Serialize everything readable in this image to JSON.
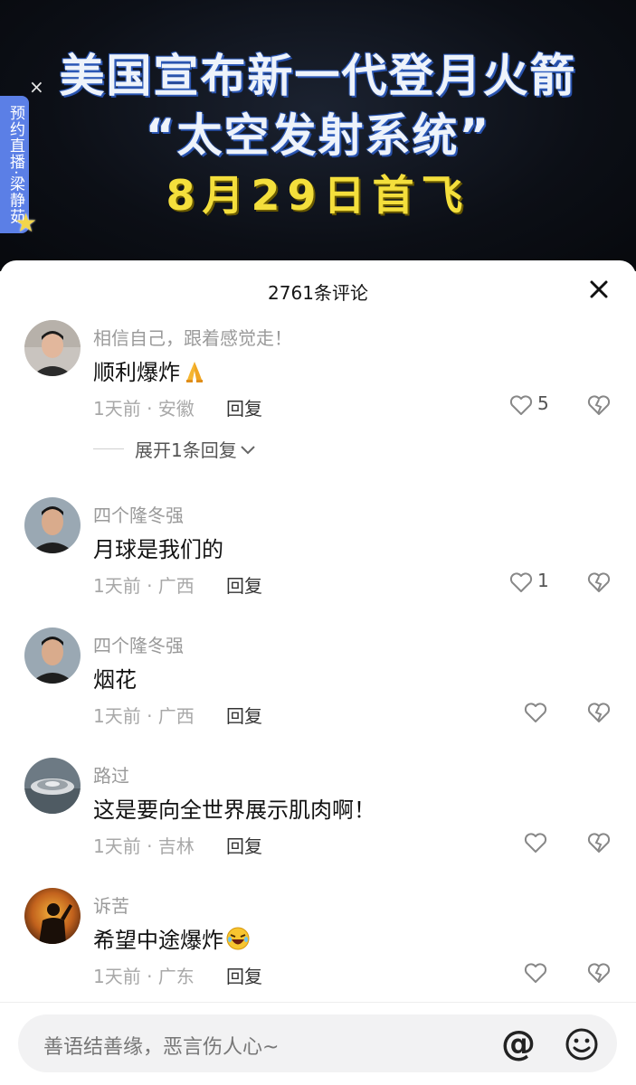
{
  "video": {
    "headline_line1": "美国宣布新一代登月火箭",
    "headline_line2": "“太空发射系统”",
    "headline_line3": "8月29日首飞",
    "live_tag": "预约直播·梁静茹",
    "live_close": "×"
  },
  "sheet": {
    "title": "2761条评论"
  },
  "comments": [
    {
      "username": "相信自己，跟着感觉走！",
      "text": "顺利爆炸",
      "time_location": "1天前 · 安徽",
      "reply_label": "回复",
      "likes": "5"
    },
    {
      "username": "四个隆冬强",
      "text": "月球是我们的",
      "time_location": "1天前 · 广西",
      "reply_label": "回复",
      "likes": "1"
    },
    {
      "username": "四个隆冬强",
      "text": "烟花",
      "time_location": "1天前 · 广西",
      "reply_label": "回复",
      "likes": ""
    },
    {
      "username": "路过",
      "text": "这是要向全世界展示肌肉啊！",
      "time_location": "1天前 · 吉林",
      "reply_label": "回复",
      "likes": ""
    },
    {
      "username": "诉苦",
      "text": "希望中途爆炸",
      "time_location": "1天前 · 广东",
      "reply_label": "回复",
      "likes": ""
    }
  ],
  "expand_replies": "展开1条回复",
  "input": {
    "placeholder": "善语结善缘，恶言伤人心~",
    "at_symbol": "@"
  },
  "icons": {
    "close": "close-icon",
    "like": "heart-icon",
    "dislike": "broken-heart-icon",
    "emoji": "smiley-icon"
  },
  "colors": {
    "headline_yellow": "#f4df3c",
    "live_tag_blue": "#5b7fe6"
  }
}
